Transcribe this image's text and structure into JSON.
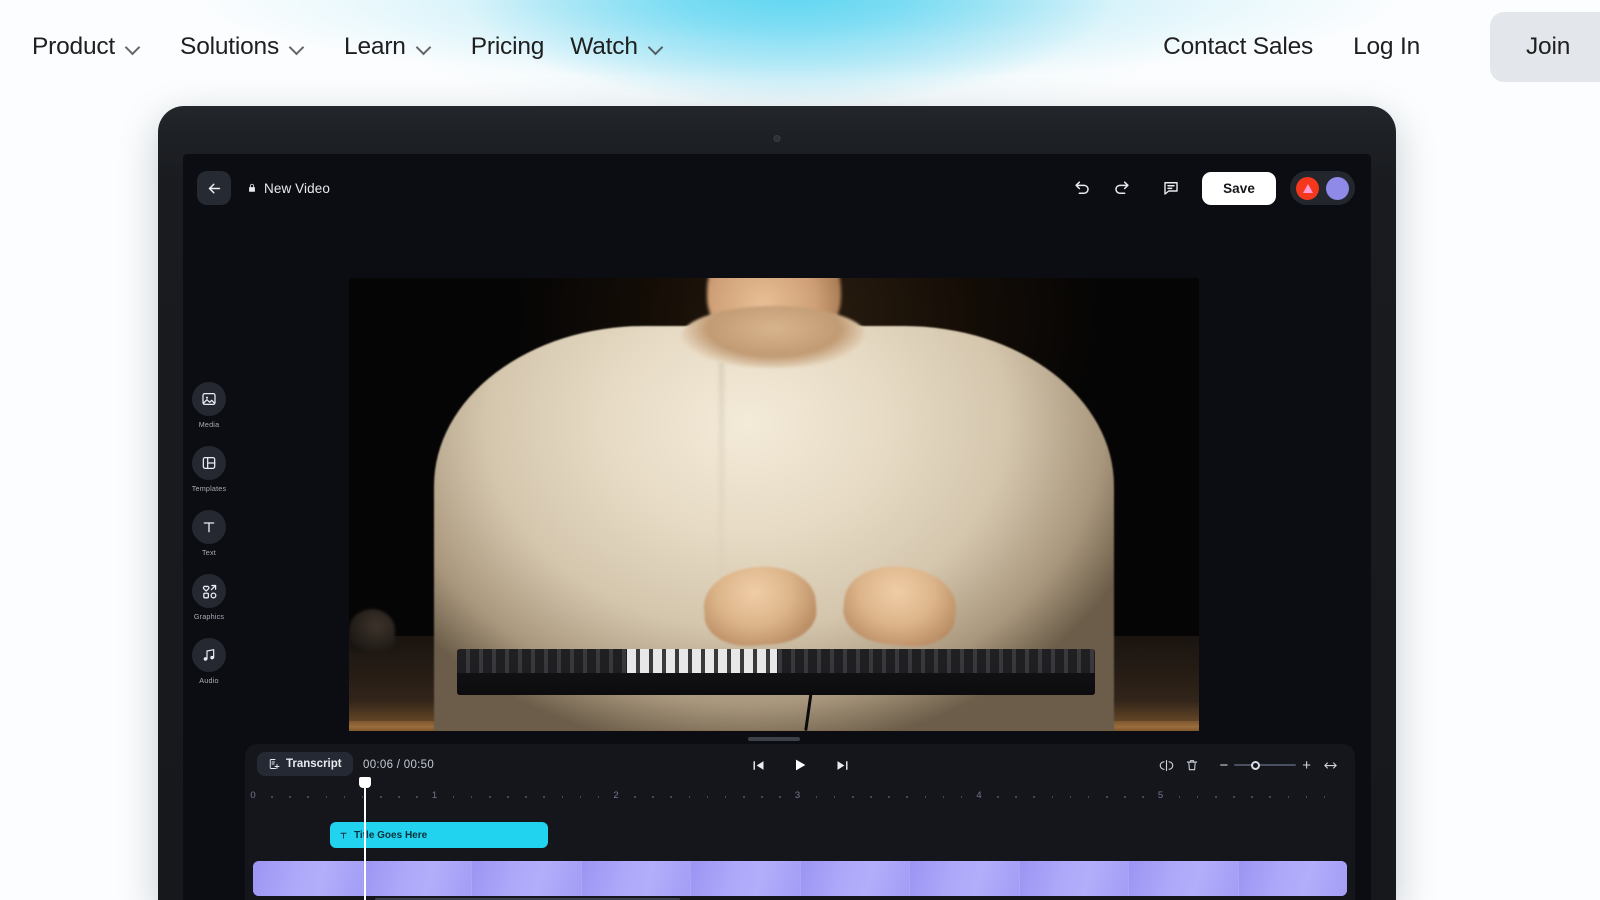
{
  "site_nav": {
    "items": [
      {
        "label": "Product",
        "has_dropdown": true,
        "icon": "chevron-down-icon"
      },
      {
        "label": "Solutions",
        "has_dropdown": true,
        "icon": "chevron-down-icon"
      },
      {
        "label": "Learn",
        "has_dropdown": true,
        "icon": "chevron-down-icon"
      },
      {
        "label": "Pricing",
        "has_dropdown": false
      },
      {
        "label": "Watch",
        "has_dropdown": true,
        "icon": "chevron-down-icon"
      }
    ],
    "contact_sales": "Contact Sales",
    "log_in": "Log In",
    "join": "Join"
  },
  "theme": {
    "page_background": "#fbfdfe",
    "glow_accent": "#5fd6f2",
    "join_button_bg": "#e3e7ec",
    "editor_bg": "#0b0d12",
    "timeline_bg": "#14161c",
    "title_clip_color": "#22d3f0",
    "video_track_color": "#a6a1f7",
    "record_button_color": "#f5381b",
    "record_glyph_color": "#ff9ad2",
    "avatar_color": "#8f8ae8"
  },
  "editor": {
    "header": {
      "back_icon": "arrow-left-icon",
      "lock_icon": "lock-icon",
      "project_title": "New Video",
      "undo_icon": "undo-icon",
      "redo_icon": "redo-icon",
      "comment_icon": "comment-icon",
      "save_label": "Save",
      "record_icon": "record-triangle-icon",
      "avatar_icon": "avatar"
    },
    "rail": {
      "items": [
        {
          "label": "Media",
          "icon": "image-icon"
        },
        {
          "label": "Templates",
          "icon": "layout-icon"
        },
        {
          "label": "Text",
          "icon": "text-t-icon"
        },
        {
          "label": "Graphics",
          "icon": "shapes-icon"
        },
        {
          "label": "Audio",
          "icon": "music-note-icon"
        }
      ]
    },
    "preview": {
      "description": "Person in a cream oversized shirt typing on a mechanical keyboard at a dark desk",
      "resize_handle": "preview-resize-handle"
    },
    "timeline": {
      "transcript_label": "Transcript",
      "transcript_icon": "transcript-doc-icon",
      "timecode": "00:06 / 00:50",
      "current_time": "00:06",
      "total_time": "00:50",
      "playback": {
        "skip_back_icon": "skip-back-icon",
        "play_icon": "play-icon",
        "skip_forward_icon": "skip-forward-icon"
      },
      "tools": {
        "split_icon": "split-clip-icon",
        "delete_icon": "trash-icon",
        "zoom_out_label": "−",
        "zoom_in_label": "+",
        "fit_icon": "fit-horizontal-icon",
        "zoom_value": 35
      },
      "ruler": {
        "labels": [
          "0",
          "1",
          "2",
          "3",
          "4",
          "5"
        ],
        "minor_ticks_per_interval": 9
      },
      "clips": [
        {
          "type": "title",
          "label": "Title Goes Here",
          "icon": "text-t-icon",
          "color": "#22d3f0"
        },
        {
          "type": "video",
          "label": "",
          "color": "#a6a1f7",
          "thumbnail_count": 10
        }
      ],
      "playhead_label": "playhead",
      "scrollbar_label": "timeline-horizontal-scrollbar"
    }
  }
}
